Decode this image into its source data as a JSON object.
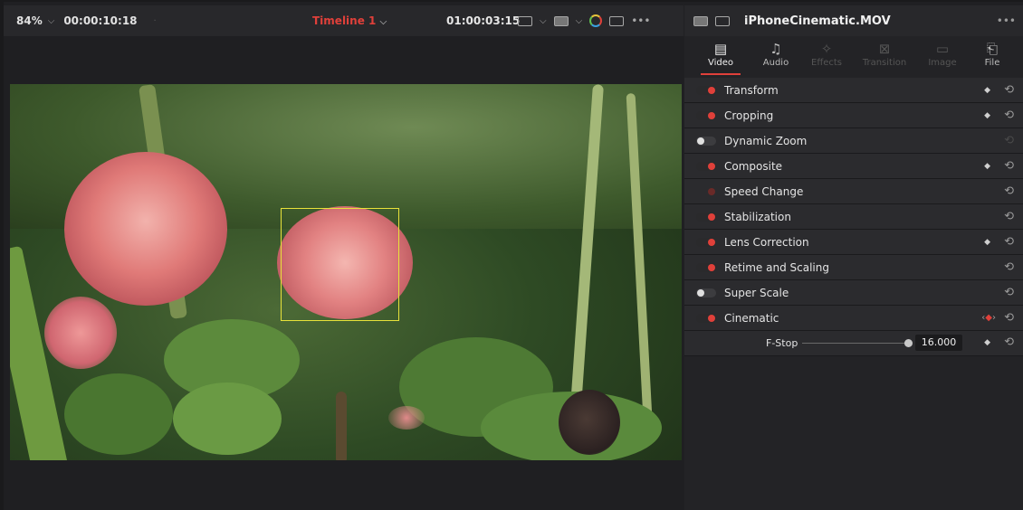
{
  "viewer": {
    "zoom": "84%",
    "source_timecode": "00:00:10:18",
    "timeline_name": "Timeline 1",
    "record_timecode": "01:00:03:15",
    "more": "•••"
  },
  "inspector": {
    "clip_name": "iPhoneCinematic.MOV",
    "more": "•••",
    "tabs": [
      {
        "label": "Video",
        "icon": "film-icon",
        "state": "active"
      },
      {
        "label": "Audio",
        "icon": "music-note-icon",
        "state": "on"
      },
      {
        "label": "Effects",
        "icon": "magic-wand-icon",
        "state": "dim"
      },
      {
        "label": "Transition",
        "icon": "transition-icon",
        "state": "dim"
      },
      {
        "label": "Image",
        "icon": "image-icon",
        "state": "dim"
      },
      {
        "label": "File",
        "icon": "file-icon",
        "state": "on"
      }
    ],
    "sections": [
      {
        "label": "Transform",
        "toggle": "on",
        "keyframe": true
      },
      {
        "label": "Cropping",
        "toggle": "on",
        "keyframe": true
      },
      {
        "label": "Dynamic Zoom",
        "toggle": "off",
        "keyframe": false
      },
      {
        "label": "Composite",
        "toggle": "on",
        "keyframe": true
      },
      {
        "label": "Speed Change",
        "toggle": "dim",
        "keyframe": false
      },
      {
        "label": "Stabilization",
        "toggle": "on",
        "keyframe": false
      },
      {
        "label": "Lens Correction",
        "toggle": "on",
        "keyframe": true
      },
      {
        "label": "Retime and Scaling",
        "toggle": "on",
        "keyframe": false
      },
      {
        "label": "Super Scale",
        "toggle": "off",
        "keyframe": false
      },
      {
        "label": "Cinematic",
        "toggle": "on",
        "keyframe": false
      }
    ],
    "fstop": {
      "label": "F-Stop",
      "value": "16.000"
    }
  },
  "colors": {
    "accent": "#e0403a",
    "tracker": "#e8e23a"
  }
}
